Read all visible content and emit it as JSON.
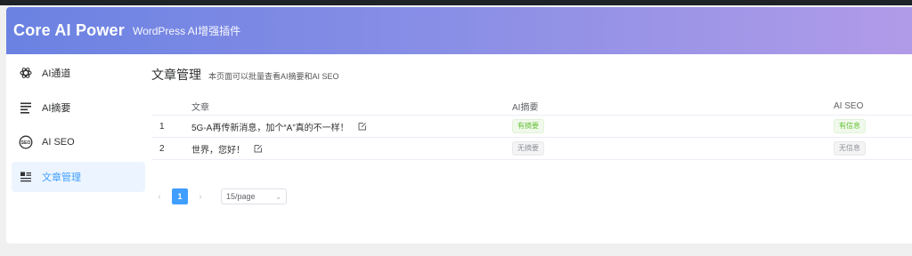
{
  "header": {
    "brand": "Core AI Power",
    "subtitle": "WordPress AI增强插件"
  },
  "sidebar": {
    "items": [
      {
        "label": "AI通道",
        "icon": "openai-icon",
        "active": false
      },
      {
        "label": "AI摘要",
        "icon": "document-lines-icon",
        "active": false
      },
      {
        "label": "AI SEO",
        "icon": "seo-icon",
        "active": false
      },
      {
        "label": "文章管理",
        "icon": "article-list-icon",
        "active": true
      }
    ]
  },
  "main": {
    "title": "文章管理",
    "description": "本页面可以批量查看AI摘要和AI SEO"
  },
  "table": {
    "columns": [
      "",
      "文章",
      "AI摘要",
      "AI SEO"
    ],
    "rows": [
      {
        "index": "1",
        "title": "5G-A再传新消息，加个“A”真的不一样！",
        "summary": "有摘要",
        "seo": "有信息"
      },
      {
        "index": "2",
        "title": "世界，您好！",
        "summary": "无摘要",
        "seo": "无信息"
      }
    ]
  },
  "pagination": {
    "prev": "‹",
    "current": "1",
    "next": "›",
    "page_size": "15/page"
  },
  "colors": {
    "accent": "#409eff",
    "header_start": "#6b82e2",
    "header_end": "#b19be8",
    "tag_positive": "#67c23a",
    "tag_neutral": "#909399"
  }
}
